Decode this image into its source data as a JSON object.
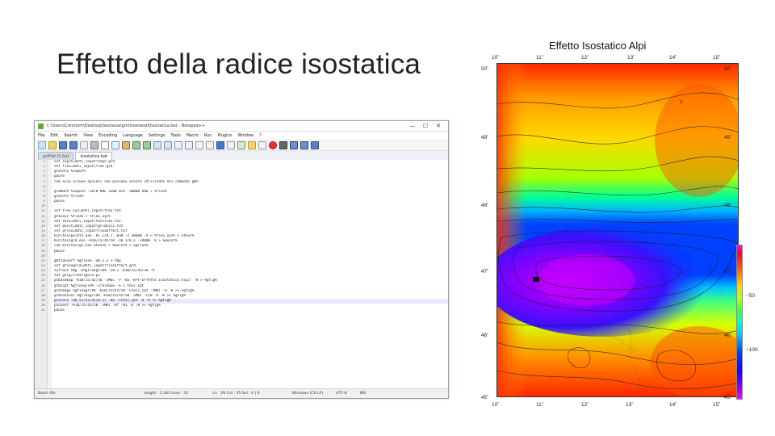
{
  "slide": {
    "title": "Effetto della radice isostatica"
  },
  "editor": {
    "window_title": "C:\\Users\\Cenmom\\Desktop\\Isostasia\\gmtisostasiaf\\Isostatica.bat - Notepad++",
    "window_controls": [
      "—",
      "☐",
      "✕"
    ],
    "menu": [
      "File",
      "Edit",
      "Search",
      "View",
      "Encoding",
      "Language",
      "Settings",
      "Tools",
      "Macro",
      "Run",
      "Plugins",
      "Window",
      "?"
    ],
    "tabs": [
      "gofflat.f1.bat",
      "Isostatica.bat"
    ],
    "active_tab": 1,
    "lines": [
      {
        "n": "1",
        "t": "set input=dati_input\\topo.grd"
      },
      {
        "n": "2",
        "t": "set flex=dati_input\\flex.grd"
      },
      {
        "n": "3",
        "t": "grdinfo %input%"
      },
      {
        "n": "4",
        "t": "pause"
      },
      {
        "n": "5",
        "t": "rem ecco alcune opzioni che possono essere utilizzate nei comandi gmt."
      },
      {
        "n": "6",
        "t": ""
      },
      {
        "n": "7",
        "t": "grdmath %input% -2670 MUL 3300 DIV -30000 ADD = %flex%"
      },
      {
        "n": "8",
        "t": "grdinfo %flex%"
      },
      {
        "n": "9",
        "t": "pause"
      },
      {
        "n": "10",
        "t": ""
      },
      {
        "n": "11",
        "t": "set flex_xyz=dati_input\\flex.txt"
      },
      {
        "n": "12",
        "t": "grd2xyz %flex% > %flex_xyz%"
      },
      {
        "n": "13",
        "t": "set tess=dati_input\\tessflex.txt"
      },
      {
        "n": "14",
        "t": "set point=dati_input\\gridCalc.txt"
      },
      {
        "n": "15",
        "t": "set gflex=dati_input\\flexEffect.txt"
      },
      {
        "n": "16",
        "t": "bin\\tesspoints.exe -R1.1/0.1 -B30 -Z 30000 -V < %flex_xyz% > %tess%"
      },
      {
        "n": "17",
        "t": "bin\\tessgrd.exe -R10/15/45/50 -I0.1/0.1 -Z4000 -V > %point%"
      },
      {
        "n": "18",
        "t": "rem bin\\tessgz.exe %tess% < %point% > %gflex%"
      },
      {
        "n": "19",
        "t": "pause"
      },
      {
        "n": "20",
        "t": ""
      },
      {
        "n": "21",
        "t": "gmtconvert %gflex% -o0,1,3 > tmp"
      },
      {
        "n": "22",
        "t": "set gflexgrid=dati_input\\flexEffect.grd"
      },
      {
        "n": "23",
        "t": "surface tmp -G%gflexgrid% -I0.1 -R10/15/45/50 -V"
      },
      {
        "n": "24",
        "t": "set gfig=flexFigure.ps"
      },
      {
        "n": "25",
        "t": "psbasemap -R10/15/45/50 -JM6i -P -Ba -B+t\"Effetto Isostatico Alpi\" -K > %gfig%"
      },
      {
        "n": "26",
        "t": "grd2cpt %gflexgrid% -Crainbow -E > tess.cpt"
      },
      {
        "n": "27",
        "t": "grdimage %gflexgrid% -R10/15/45/50 -Ctess.cpt -JM6i -O -K >> %gfig%"
      },
      {
        "n": "28",
        "t": "grdcontour %gflexgrid% -R10/15/45/50 -JM6i -C10 -O -K >> %gfig%"
      },
      {
        "n": "29",
        "t": "psscale -D6.5i/3i/4i/0.1i -Ba -Ctess.cpt -O -K >> %gfig%"
      },
      {
        "n": "30",
        "t": "pscoast -R10/15/45/50 -JM6i -Df -N1 -O -W >> %gfig%"
      },
      {
        "n": "31",
        "t": "pause"
      }
    ],
    "current_line": "29",
    "status": {
      "type": "Batch file",
      "length_lines": "length : 1,343   lines : 31",
      "position": "Ln : 29   Col : 35   Sel : 0 | 0",
      "eol": "Windows (CR LF)",
      "encoding": "UTF-8",
      "mode": "INS"
    }
  },
  "map": {
    "title": "Effetto Isostatico Alpi",
    "lon_ticks": [
      "10˚",
      "11˚",
      "12˚",
      "13˚",
      "14˚",
      "15˚"
    ],
    "lat_ticks": [
      "50˚",
      "49˚",
      "48˚",
      "47˚",
      "46˚",
      "45˚"
    ],
    "colorbar_ticks": [
      "−50",
      "−100"
    ],
    "contour_label": "1"
  }
}
